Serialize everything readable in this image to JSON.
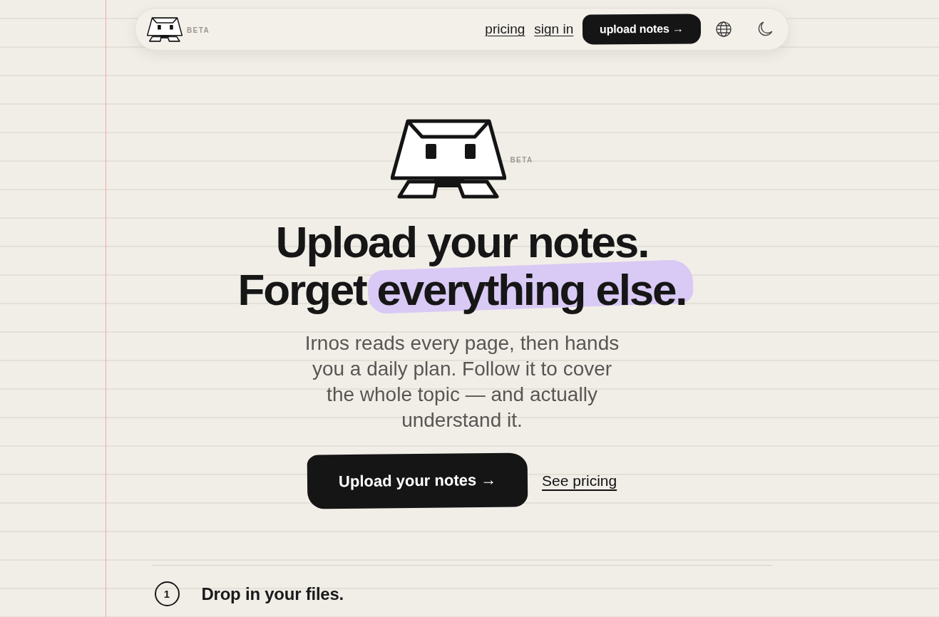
{
  "nav": {
    "beta_label": "BETA",
    "links": [
      "pricing",
      "sign in"
    ],
    "cta_button": "upload notes →"
  },
  "hero": {
    "beta_label": "BETA",
    "headline": {
      "line_1": "Upload your notes.",
      "line_2": "Forget",
      "highlighted": "everything else."
    },
    "subtitle": "Irnos reads every page, then hands you a daily plan. Follow it to cover the whole topic — and actually understand it.",
    "primary_button": "Upload your notes →",
    "secondary_link": "See pricing"
  },
  "steps": [
    {
      "number": "1",
      "title": "Drop in your files."
    }
  ]
}
